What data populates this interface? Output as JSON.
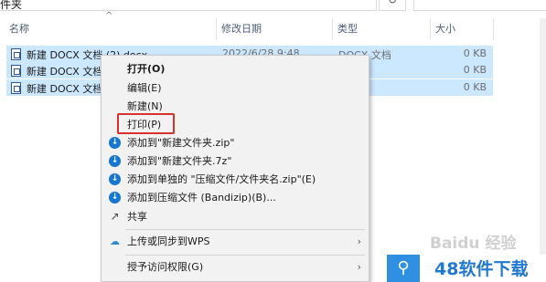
{
  "address": {
    "path_fragment": "件夹"
  },
  "columns": {
    "name": "名称",
    "date": "修改日期",
    "type": "类型",
    "size": "大小"
  },
  "files": [
    {
      "name": "新建 DOCX 文档 (2).docx",
      "date": "2022/6/28 9:48",
      "type": "DOCX 文档",
      "size": "0 KB"
    },
    {
      "name": "新建 DOCX 文档",
      "date": "",
      "type": "文档",
      "size": "0 KB"
    },
    {
      "name": "新建 DOCX 文档",
      "date": "",
      "type": "文档",
      "size": "0 KB"
    }
  ],
  "context_menu": {
    "open": "打开(O)",
    "edit": "编辑(E)",
    "new": "新建(N)",
    "print": "打印(P)",
    "add_zip": "添加到\"新建文件夹.zip\"",
    "add_7z": "添加到\"新建文件夹.7z\"",
    "add_separate": "添加到单独的 \"压缩文件/文件夹名.zip\"(E)",
    "add_bandizip": "添加到压缩文件 (Bandizip)(B)...",
    "share": "共享",
    "upload_wps": "上传或同步到WPS",
    "grant_access": "授予访问权限(G)"
  },
  "icons": {
    "bandizip": "bandizip-icon",
    "share": "share-icon",
    "wps_cloud": "wps-cloud-icon"
  },
  "colors": {
    "selection": "#cce8ff",
    "highlight_border": "#d9312b",
    "menu_bg": "#f2f2f2"
  },
  "watermark": {
    "baidu": "Baidu 经验",
    "site": "48软件下载"
  }
}
